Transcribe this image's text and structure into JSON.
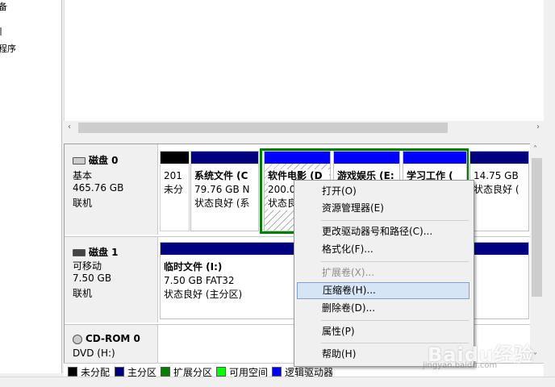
{
  "left_pane": {
    "line1": "备",
    "line2": "程序"
  },
  "disks": [
    {
      "name": "磁盘 0",
      "type": "基本",
      "size": "465.76 GB",
      "status": "联机",
      "partitions": [
        {
          "line1": "",
          "line2": "201",
          "line3": "未分"
        },
        {
          "line1": "系统文件 (C",
          "line2": "79.76 GB N",
          "line3": "状态良好 (系"
        },
        {
          "line1": "软件电影 (D",
          "line2": "200.0",
          "line3": "状态良"
        },
        {
          "line1": "游戏娱乐 (E:",
          "line2": "",
          "line3": ""
        },
        {
          "line1": "学习工作 (",
          "line2": "",
          "line3": ""
        },
        {
          "line1": "",
          "line2": "14.75 GB",
          "line3": "状态良好 ("
        }
      ]
    },
    {
      "name": "磁盘 1",
      "type": "可移动",
      "size": "7.50 GB",
      "status": "联机",
      "partitions": [
        {
          "line1": "临时文件 (I:)",
          "line2": "7.50 GB FAT32",
          "line3": "状态良好 (主分区)"
        }
      ]
    },
    {
      "name": "CD-ROM 0",
      "type": "DVD (H:)",
      "size": "",
      "status": ""
    }
  ],
  "legend": [
    {
      "label": "未分配",
      "color": "#000000"
    },
    {
      "label": "主分区",
      "color": "#000080"
    },
    {
      "label": "扩展分区",
      "color": "#008000"
    },
    {
      "label": "可用空间",
      "color": "#00ff00"
    },
    {
      "label": "逻辑驱动器",
      "color": "#0000ff"
    }
  ],
  "context_menu": [
    {
      "label": "打开(O)",
      "disabled": false
    },
    {
      "label": "资源管理器(E)",
      "disabled": false
    },
    {
      "label": "更改驱动器号和路径(C)...",
      "disabled": false
    },
    {
      "label": "格式化(F)...",
      "disabled": false
    },
    {
      "label": "扩展卷(X)...",
      "disabled": true
    },
    {
      "label": "压缩卷(H)...",
      "disabled": false,
      "highlighted": true
    },
    {
      "label": "删除卷(D)...",
      "disabled": false
    },
    {
      "label": "属性(P)",
      "disabled": false
    },
    {
      "label": "帮助(H)",
      "disabled": false
    }
  ],
  "watermark": {
    "logo": "Baidu经验",
    "url": "jingyan.baidu.com"
  },
  "colors": {
    "primary": "#000080",
    "logical": "#0000ff",
    "extended_border": "#008000",
    "unallocated": "#000000",
    "highlight": "#d5e5f5"
  }
}
